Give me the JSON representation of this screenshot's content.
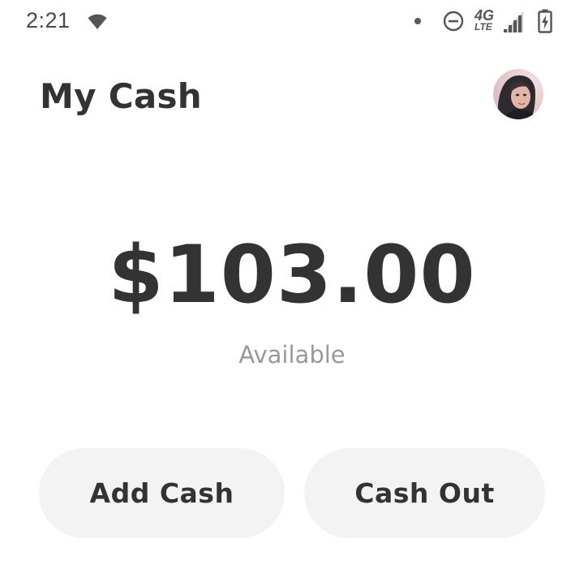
{
  "status_bar": {
    "time": "2:21",
    "network_type_top": "4G",
    "network_type_bottom": "LTE",
    "icons": [
      "wifi-icon",
      "notification-dot-icon",
      "do-not-disturb-icon",
      "signal-icon",
      "battery-charging-icon"
    ]
  },
  "header": {
    "title": "My Cash",
    "avatar_icon": "profile-avatar"
  },
  "balance": {
    "amount": "$103.00",
    "label": "Available"
  },
  "actions": {
    "add_cash": "Add Cash",
    "cash_out": "Cash Out"
  },
  "colors": {
    "text_primary": "#333333",
    "text_secondary": "#999999",
    "button_background": "#f3f3f3",
    "background": "#ffffff"
  }
}
